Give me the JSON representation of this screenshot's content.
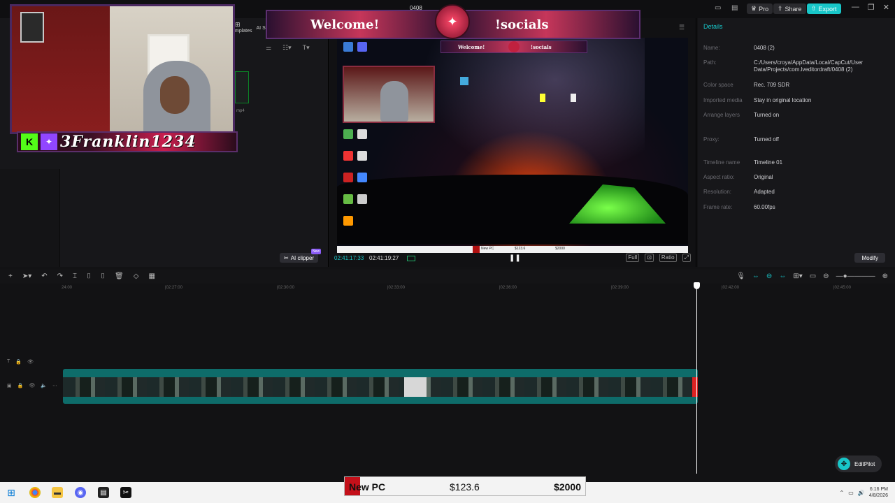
{
  "topbar": {
    "pro_label": "Pro",
    "share_label": "Share",
    "export_label": "Export",
    "banner_num": "0408"
  },
  "media": {
    "tab_templates": "mplates",
    "tab_ai": "AI S",
    "ai_clipper": "AI clipper",
    "ai_clipper_badge": "New",
    "thumb_label": "mp4"
  },
  "overlay": {
    "streamer_name": "3Franklin1234",
    "welcome": "Welcome!",
    "socials": "!socials",
    "kick_glyph": "K",
    "twitch_glyph": "✦"
  },
  "player": {
    "current_time": "02:41:17:33",
    "total_time": "02:41:19:27",
    "full_label": "Full",
    "ratio_label": "Ratio",
    "screen_goal_name": "New PC",
    "screen_goal_cur": "$123.6",
    "screen_goal_target": "$2000"
  },
  "details": {
    "title": "Details",
    "rows": [
      {
        "label": "Name:",
        "value": "0408 (2)"
      },
      {
        "label": "Path:",
        "value": "C:/Users/croya/AppData/Local/CapCut/User Data/Projects/com.lveditordraft/0408 (2)"
      },
      {
        "label": "Color space",
        "value": "Rec. 709 SDR"
      },
      {
        "label": "Imported media",
        "value": "Stay in original location"
      },
      {
        "label": "Arrange layers",
        "value": "Turned on"
      },
      {
        "label": "Proxy:",
        "value": "Turned off"
      },
      {
        "label": "Timeline name",
        "value": "Timeline 01"
      },
      {
        "label": "Aspect ratio:",
        "value": "Original"
      },
      {
        "label": "Resolution:",
        "value": "Adapted"
      },
      {
        "label": "Frame rate:",
        "value": "60.00fps"
      }
    ],
    "modify_label": "Modify"
  },
  "timeline": {
    "ticks": [
      "24:00",
      "|02:27:00",
      "|02:30:00",
      "|02:33:00",
      "|02:36:00",
      "|02:39:00",
      "|02:42:00",
      "|02:45:00"
    ],
    "editpilot": "EditPilot"
  },
  "goal": {
    "name": "New PC",
    "current": "$123.6",
    "target": "$2000",
    "progress": 0.062,
    "fill_color": "#c4101a"
  },
  "taskbar": {
    "time": "6:16 PM",
    "date": "4/8/2026"
  },
  "colors": {
    "accent": "#18c6c8",
    "background": "#121214"
  }
}
